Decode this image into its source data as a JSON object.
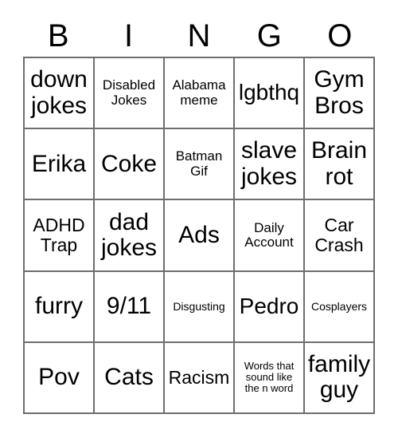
{
  "card": {
    "header_letters": [
      "B",
      "I",
      "N",
      "G",
      "O"
    ],
    "columns": 5,
    "rows": 5,
    "border_color": "#6e6e6e",
    "background_color": "#ffffff",
    "text_color": "#000000",
    "cells": [
      {
        "text": "down jokes",
        "size": "fs-xl"
      },
      {
        "text": "Disabled Jokes",
        "size": "fs-sm"
      },
      {
        "text": "Alabama meme",
        "size": "fs-sm"
      },
      {
        "text": "lgbthq",
        "size": "fs-lg"
      },
      {
        "text": "Gym Bros",
        "size": "fs-xl"
      },
      {
        "text": "Erika",
        "size": "fs-xl"
      },
      {
        "text": "Coke",
        "size": "fs-xl"
      },
      {
        "text": "Batman Gif",
        "size": "fs-sm"
      },
      {
        "text": "slave jokes",
        "size": "fs-xl"
      },
      {
        "text": "Brain rot",
        "size": "fs-xl"
      },
      {
        "text": "ADHD Trap",
        "size": "fs-md"
      },
      {
        "text": "dad jokes",
        "size": "fs-xl"
      },
      {
        "text": "Ads",
        "size": "fs-xl"
      },
      {
        "text": "Daily Account",
        "size": "fs-sm"
      },
      {
        "text": "Car Crash",
        "size": "fs-md"
      },
      {
        "text": "furry",
        "size": "fs-xl"
      },
      {
        "text": "9/11",
        "size": "fs-xl"
      },
      {
        "text": "Disgusting",
        "size": "fs-xs"
      },
      {
        "text": "Pedro",
        "size": "fs-lg"
      },
      {
        "text": "Cosplayers",
        "size": "fs-xs"
      },
      {
        "text": "Pov",
        "size": "fs-xl"
      },
      {
        "text": "Cats",
        "size": "fs-xl"
      },
      {
        "text": "Racism",
        "size": "fs-md"
      },
      {
        "text": "Words that sound like the n word",
        "size": "fs-xxs"
      },
      {
        "text": "family guy",
        "size": "fs-xl"
      }
    ]
  }
}
